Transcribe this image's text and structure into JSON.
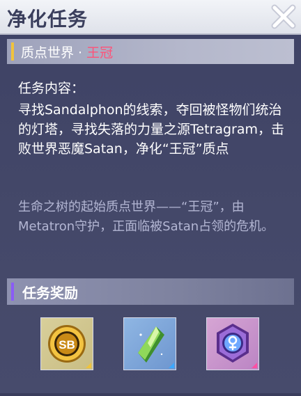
{
  "header": {
    "title": "净化任务"
  },
  "world": {
    "name": "质点世界 · ",
    "crown": "王冠"
  },
  "task": {
    "heading": "任务内容：",
    "description": "寻找Sandalphon的线索，夺回被怪物们统治的灯塔，寻找失落的力量之源Tetragram，击败世界恶魔Satan，净化“王冠”质点",
    "lore": "生命之树的起始质点世界——“王冠”，由Metatron守护，正面临被Satan占领的危机。"
  },
  "rewards": {
    "heading": "任务奖励",
    "items": [
      {
        "icon": "gold-coin-icon",
        "coin_text": "SB",
        "rarity_color": "#f0c33c"
      },
      {
        "icon": "green-crystal-icon",
        "rarity_color": "#3aa8ff"
      },
      {
        "icon": "purple-badge-icon",
        "rarity_color": "#ff4fa3"
      }
    ]
  },
  "colors": {
    "crown_highlight": "#ff5278",
    "lore_text": "#b3b6d3",
    "title_accent": "#f0c33c",
    "reward_accent": "#8a5cf6"
  }
}
